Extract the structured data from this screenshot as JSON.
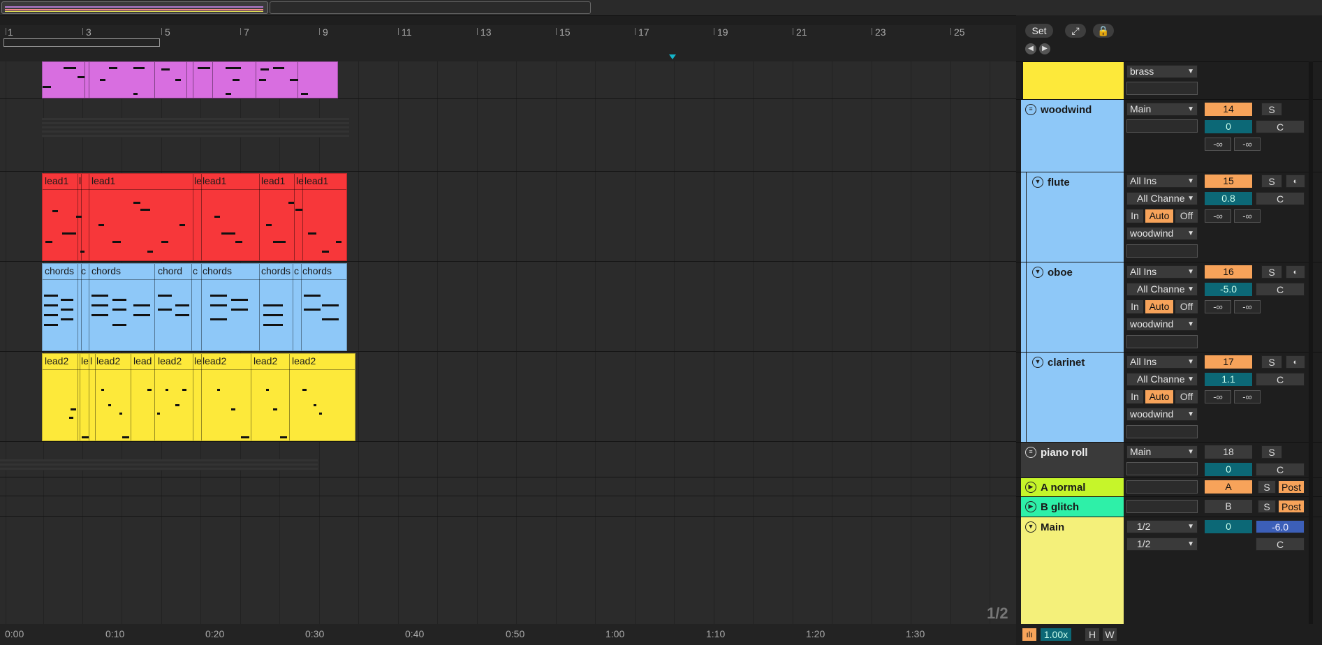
{
  "ruler": {
    "bars": [
      "1",
      "3",
      "5",
      "7",
      "9",
      "11",
      "13",
      "15",
      "17",
      "19",
      "21",
      "23",
      "25"
    ]
  },
  "timebar": {
    "labels": [
      "0:00",
      "0:10",
      "0:20",
      "0:30",
      "0:40",
      "0:50",
      "1:00",
      "1:10",
      "1:20",
      "1:30"
    ]
  },
  "page_indicator": "1/2",
  "header": {
    "set_label": "Set",
    "expand_icon": "expand-icon",
    "lock_icon": "lock-icon"
  },
  "clips": {
    "lead1": [
      "lead1",
      "l",
      "lead1",
      "le",
      "lead1",
      "lead1",
      "le",
      "lead1"
    ],
    "chords": [
      "chords",
      "c",
      "chords",
      "chord",
      "c",
      "chords",
      "chords",
      "c",
      "chords"
    ],
    "lead2": [
      "lead2",
      "le",
      "l",
      "lead2",
      "lead",
      "lead2",
      "le",
      "lead2",
      "lead2",
      "lead2"
    ]
  },
  "tracks": {
    "brass": {
      "output": "brass"
    },
    "woodwind": {
      "name": "woodwind",
      "output": "Main",
      "number": "14",
      "solo": "S",
      "volume": "0",
      "pan": "C",
      "meter_l": "-∞",
      "meter_r": "-∞"
    },
    "flute": {
      "name": "flute",
      "input": "All Ins",
      "channel": "All Channe",
      "mon_in": "In",
      "mon_auto": "Auto",
      "mon_off": "Off",
      "output": "woodwind",
      "number": "15",
      "solo": "S",
      "volume": "0.8",
      "pan": "C",
      "meter_l": "-∞",
      "meter_r": "-∞"
    },
    "oboe": {
      "name": "oboe",
      "input": "All Ins",
      "channel": "All Channe",
      "mon_in": "In",
      "mon_auto": "Auto",
      "mon_off": "Off",
      "output": "woodwind",
      "number": "16",
      "solo": "S",
      "volume": "-5.0",
      "pan": "C",
      "meter_l": "-∞",
      "meter_r": "-∞"
    },
    "clarinet": {
      "name": "clarinet",
      "input": "All Ins",
      "channel": "All Channe",
      "mon_in": "In",
      "mon_auto": "Auto",
      "mon_off": "Off",
      "output": "woodwind",
      "number": "17",
      "solo": "S",
      "volume": "1.1",
      "pan": "C",
      "meter_l": "-∞",
      "meter_r": "-∞"
    },
    "piano_roll": {
      "name": "piano roll",
      "output": "Main",
      "number": "18",
      "solo": "S",
      "volume": "0",
      "pan": "C"
    },
    "a_normal": {
      "name": "A normal",
      "letter": "A",
      "solo": "S",
      "post": "Post"
    },
    "b_glitch": {
      "name": "B glitch",
      "letter": "B",
      "solo": "S",
      "post": "Post"
    },
    "main": {
      "name": "Main",
      "out1": "1/2",
      "out2": "1/2",
      "volume": "0",
      "pan_value": "-6.0",
      "pan": "C"
    }
  },
  "footer": {
    "zoom": "1.00x",
    "h_label": "H",
    "w_label": "W",
    "waveform_icon": "waveform-icon"
  },
  "colors": {
    "purple": "#d86ee0",
    "red": "#f7373a",
    "blue": "#8ec8f8",
    "yellow": "#fde93a",
    "yellow_pale": "#f4f07a",
    "lime": "#c6f52a",
    "cyan": "#2ef0a8",
    "orange": "#f7a35a",
    "teal": "#0c6876",
    "playhead": "#14b4c8"
  }
}
